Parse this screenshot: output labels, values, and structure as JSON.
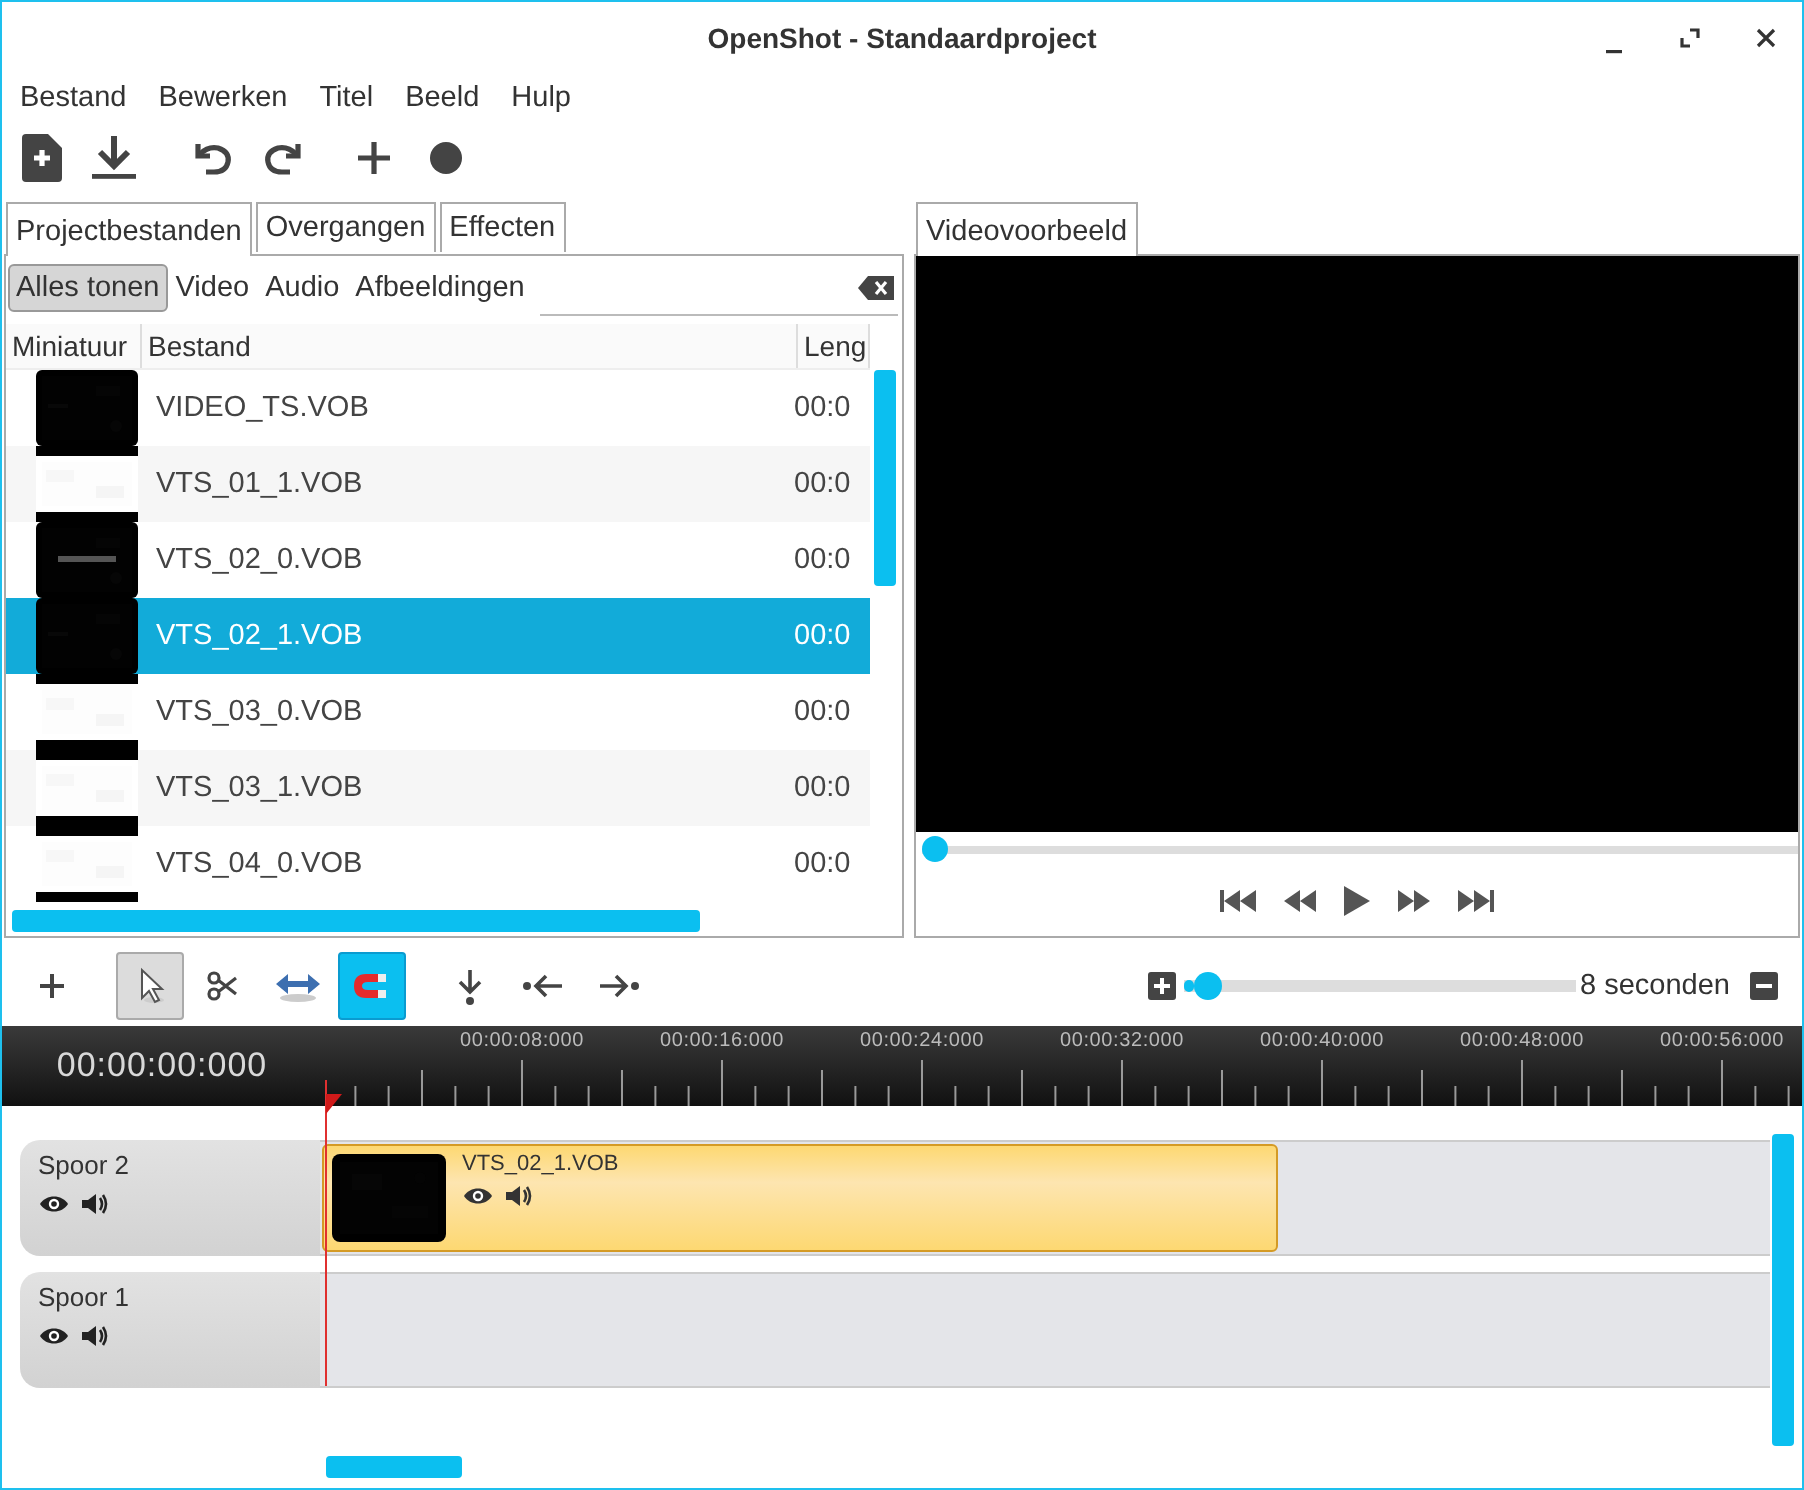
{
  "window": {
    "title": "OpenShot - Standaardproject"
  },
  "menu": [
    "Bestand",
    "Bewerken",
    "Titel",
    "Beeld",
    "Hulp"
  ],
  "project_panel": {
    "tabs": [
      {
        "label": "Projectbestanden",
        "selected": true
      },
      {
        "label": "Overgangen",
        "selected": false
      },
      {
        "label": "Effecten",
        "selected": false
      }
    ],
    "filters": [
      {
        "label": "Alles tonen",
        "selected": true
      },
      {
        "label": "Video",
        "selected": false
      },
      {
        "label": "Audio",
        "selected": false
      },
      {
        "label": "Afbeeldingen",
        "selected": false
      }
    ],
    "columns": [
      "Miniatuur",
      "Bestand",
      "Leng"
    ],
    "rows": [
      {
        "file": "VIDEO_TS.VOB",
        "length": "00:0",
        "selected": false
      },
      {
        "file": "VTS_01_1.VOB",
        "length": "00:0",
        "selected": false
      },
      {
        "file": "VTS_02_0.VOB",
        "length": "00:0",
        "selected": false
      },
      {
        "file": "VTS_02_1.VOB",
        "length": "00:0",
        "selected": true
      },
      {
        "file": "VTS_03_0.VOB",
        "length": "00:0",
        "selected": false
      },
      {
        "file": "VTS_03_1.VOB",
        "length": "00:0",
        "selected": false
      },
      {
        "file": "VTS_04_0.VOB",
        "length": "00:0",
        "selected": false
      }
    ]
  },
  "preview": {
    "tab": {
      "label": "Videovoorbeeld",
      "selected": true
    },
    "seek": {
      "level": 0
    }
  },
  "timeline_toolbar": {
    "tools": [
      {
        "kind": "add",
        "active": false
      },
      {
        "kind": "select",
        "active": true
      },
      {
        "kind": "razor",
        "active": false
      },
      {
        "kind": "resize",
        "active": false
      },
      {
        "kind": "snap",
        "active": true
      },
      {
        "kind": "marker",
        "active": false
      },
      {
        "kind": "previous",
        "active": false
      },
      {
        "kind": "next",
        "active": false
      }
    ],
    "zoom": {
      "level": 0.03,
      "label": "8 seconden"
    }
  },
  "timeline": {
    "timecode": "00:00:00:000",
    "ruler_labels": [
      "00:00:08:000",
      "00:00:16:000",
      "00:00:24:000",
      "00:00:32:000",
      "00:00:40:000",
      "00:00:48:000",
      "00:00:56:000"
    ],
    "tracks": [
      {
        "name": "Spoor 2",
        "clips": [
          {
            "name": "VTS_02_1.VOB"
          }
        ]
      },
      {
        "name": "Spoor 1"
      }
    ]
  }
}
